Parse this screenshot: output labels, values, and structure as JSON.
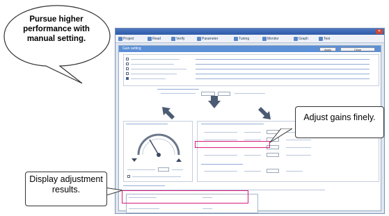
{
  "callouts": {
    "speech": "Pursue higher performance with manual setting.",
    "adjust_gains": "Adjust gains finely.",
    "display_results": "Display adjustment results."
  },
  "window": {
    "toolbar": [
      "Project",
      "Read",
      "Verify",
      "Parameter",
      "Tuning",
      "Monitor",
      "Graph",
      "Test"
    ],
    "header_label": "Gain setting",
    "header_buttons": [
      "Apply",
      "Close"
    ]
  },
  "colors": {
    "highlight": "#d8197c",
    "header_blue": "#5b8fd6",
    "arrow": "#4b5b73"
  }
}
